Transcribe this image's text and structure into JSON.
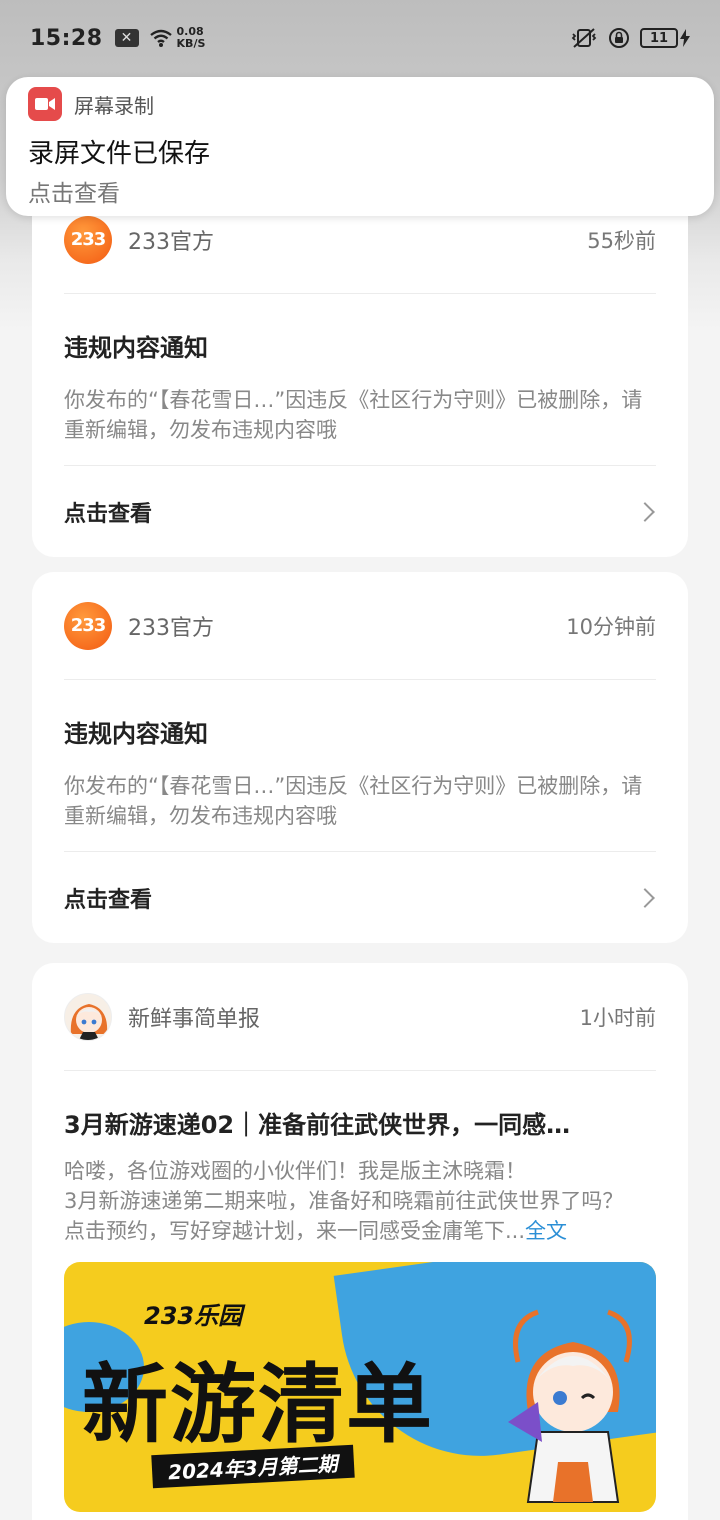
{
  "status_bar": {
    "time": "15:28",
    "x_icon": "x-icon",
    "speed_value": "0.08",
    "speed_unit": "KB/S",
    "battery": "11"
  },
  "notification": {
    "app_name": "屏幕录制",
    "title": "录屏文件已保存",
    "text": "点击查看"
  },
  "cards": [
    {
      "sender": "233官方",
      "avatar_text": "233",
      "time": "55秒前",
      "title": "违规内容通知",
      "body": "你发布的“【春花雪日…”因违反《社区行为守则》已被删除，请重新编辑，勿发布违规内容哦",
      "action": "点击查看"
    },
    {
      "sender": "233官方",
      "avatar_text": "233",
      "time": "10分钟前",
      "title": "违规内容通知",
      "body": "你发布的“【春花雪日…”因违反《社区行为守则》已被删除，请重新编辑，勿发布违规内容哦",
      "action": "点击查看"
    }
  ],
  "news": {
    "sender": "新鲜事简单报",
    "time": "1小时前",
    "title": "3月新游速递02｜准备前往武侠世界，一同感…",
    "line1": "哈喽，各位游戏圈的小伙伴们！我是版主沐晓霜！",
    "line2": "3月新游速递第二期来啦，准备好和晓霜前往武侠世界了吗？",
    "line3": "点击预约，写好穿越计划，来一同感受金庸笔下...",
    "full_text": "全文",
    "banner": {
      "brand": "233乐园",
      "title": "新游清单",
      "subtitle": "2024年3月第二期"
    }
  }
}
